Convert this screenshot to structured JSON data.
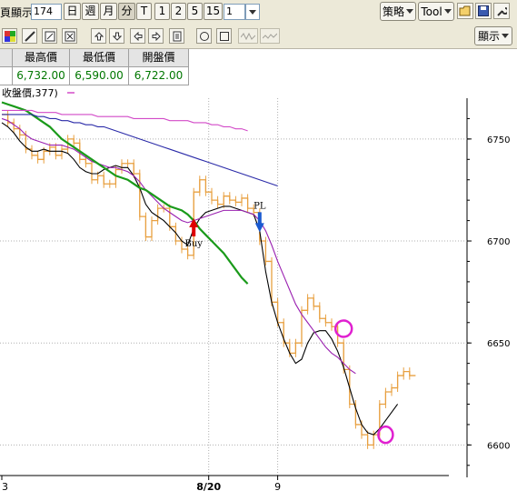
{
  "toolbar": {
    "period_label": "頁顯示",
    "period_value": "174",
    "interval_buttons": [
      "日",
      "週",
      "月",
      "分",
      "T",
      "1",
      "2",
      "5",
      "15"
    ],
    "interval_selected": "分",
    "interval_value": "1",
    "strategy_label": "策略",
    "tool_label": "Tool",
    "display_label": "顯示"
  },
  "icons": {
    "row2_left": [
      "color-icon",
      "draw-icon",
      "edit-icon",
      "zoom-icon"
    ],
    "row2_nav": [
      "arrow-up-icon",
      "arrow-down-icon",
      "arrow-left-icon",
      "arrow-right-icon",
      "page-icon"
    ],
    "row2_shapes": [
      "circle-icon",
      "square-icon",
      "wave-icon",
      "wave2-icon"
    ],
    "row1_right": [
      "open-folder-icon",
      "save-icon",
      "wrench-icon"
    ]
  },
  "quote": {
    "headers": [
      "最高價",
      "最低價",
      "開盤價"
    ],
    "values": [
      "6,732.00",
      "6,590.00",
      "6,722.00"
    ]
  },
  "chart_data": {
    "type": "line",
    "title": "收盤價,377)",
    "y_axis_ticks": [
      6750,
      6700,
      6650,
      6600
    ],
    "ylim": [
      6585,
      6770
    ],
    "x_axis_labels": [
      "3",
      "8/20",
      "9"
    ],
    "annotations": [
      {
        "text": "Buy",
        "x_index": 32,
        "value": 6700
      },
      {
        "text": "PL",
        "x_index": 43,
        "value": 6715
      }
    ],
    "series": [
      {
        "color": "#e8a040",
        "kind": "step",
        "values": [
          6762,
          6758,
          6755,
          6752,
          6745,
          6742,
          6740,
          6744,
          6746,
          6742,
          6745,
          6750,
          6748,
          6740,
          6738,
          6730,
          6732,
          6728,
          6728,
          6735,
          6738,
          6738,
          6733,
          6712,
          6702,
          6710,
          6716,
          6716,
          6707,
          6700,
          6696,
          6693,
          6724,
          6730,
          6724,
          6720,
          6718,
          6722,
          6720,
          6719,
          6721,
          6716,
          6714,
          6700,
          6690,
          6670,
          6660,
          6650,
          6645,
          6650,
          6666,
          6672,
          6668,
          6662,
          6660,
          6658,
          6650,
          6637,
          6620,
          6610,
          6605,
          6600,
          6605,
          6620,
          6626,
          6628,
          6634,
          6636,
          6634
        ]
      },
      {
        "color": "#000000",
        "kind": "line",
        "values": [
          6758,
          6756,
          6753,
          6749,
          6746,
          6744,
          6744,
          6745,
          6744,
          6744,
          6744,
          6743,
          6740,
          6736,
          6734,
          6733,
          6733,
          6735,
          6736,
          6737,
          6736,
          6736,
          6732,
          6726,
          6718,
          6714,
          6712,
          6710,
          6707,
          6704,
          6700,
          6698,
          6706,
          6711,
          6714,
          6715,
          6716,
          6717,
          6717,
          6716,
          6715,
          6714,
          6713,
          6705,
          6685,
          6670,
          6660,
          6652,
          6645,
          6640,
          6642,
          6650,
          6655,
          6656,
          6656,
          6652,
          6646,
          6638,
          6628,
          6618,
          6610,
          6606,
          6605,
          6608,
          6612,
          6616,
          6620
        ]
      },
      {
        "color": "#9a20b0",
        "kind": "line",
        "values": [
          6760,
          6759,
          6757,
          6755,
          6752,
          6750,
          6749,
          6748,
          6747,
          6747,
          6747,
          6746,
          6745,
          6743,
          6741,
          6739,
          6738,
          6737,
          6736,
          6736,
          6735,
          6734,
          6732,
          6729,
          6725,
          6722,
          6719,
          6716,
          6714,
          6712,
          6710,
          6709,
          6710,
          6711,
          6712,
          6713,
          6714,
          6715,
          6715,
          6715,
          6715,
          6714,
          6713,
          6710,
          6705,
          6698,
          6690,
          6683,
          6676,
          6669,
          6664,
          6660,
          6656,
          6652,
          6648,
          6645,
          6643,
          6640,
          6637,
          6635
        ]
      },
      {
        "color": "#1a9a1a",
        "kind": "line",
        "values": [
          6768,
          6767,
          6766,
          6765,
          6764,
          6762,
          6760,
          6758,
          6756,
          6753,
          6750,
          6748,
          6746,
          6744,
          6742,
          6740,
          6738,
          6736,
          6734,
          6732,
          6731,
          6730,
          6728,
          6726,
          6725,
          6723,
          6721,
          6719,
          6717,
          6716,
          6715,
          6713,
          6710,
          6706,
          6703,
          6700,
          6697,
          6694,
          6690,
          6686,
          6682,
          6679
        ]
      },
      {
        "color": "#2a2aa8",
        "kind": "line",
        "values": [
          6762,
          6762,
          6762,
          6762,
          6762,
          6762,
          6761,
          6761,
          6760,
          6760,
          6759,
          6759,
          6758,
          6758,
          6757,
          6757,
          6756,
          6756,
          6755,
          6754,
          6753,
          6752,
          6751,
          6750,
          6749,
          6748,
          6747,
          6746,
          6745,
          6744,
          6743,
          6742,
          6741,
          6740,
          6739,
          6738,
          6737,
          6736,
          6735,
          6734,
          6733,
          6732,
          6731,
          6730,
          6729,
          6728,
          6727
        ]
      },
      {
        "color": "#d24ac8",
        "kind": "line",
        "values": [
          6764,
          6764,
          6764,
          6764,
          6764,
          6764,
          6763,
          6763,
          6763,
          6763,
          6762,
          6762,
          6762,
          6762,
          6762,
          6762,
          6761,
          6761,
          6761,
          6761,
          6761,
          6761,
          6760,
          6760,
          6760,
          6760,
          6760,
          6760,
          6759,
          6759,
          6759,
          6759,
          6758,
          6758,
          6758,
          6757,
          6757,
          6756,
          6756,
          6755,
          6755,
          6754
        ]
      }
    ]
  }
}
